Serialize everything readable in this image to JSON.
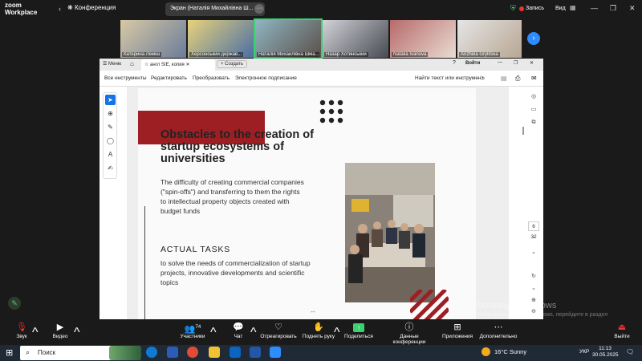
{
  "zoom": {
    "logo_line1": "zoom",
    "logo_line2": "Workplace",
    "conference_label": "Конференция",
    "share_title": "Экран (Наталія Михайлівна Ш...",
    "record_label": "Запись",
    "view_label": "Вид",
    "accent_green": "#3bd16f",
    "accent_blue": "#2d8cff"
  },
  "gallery": [
    {
      "name": "Катерина Леміш",
      "active": false
    },
    {
      "name": "Херсонський держав...",
      "active": false
    },
    {
      "name": "Наталія Михайлівна Шма...",
      "active": true
    },
    {
      "name": "Назар Хотинський",
      "active": false
    },
    {
      "name": "Natalia Ivanova",
      "active": false
    },
    {
      "name": "Anzhela Grylitska",
      "active": false
    }
  ],
  "acrobat": {
    "menu_label": "Меню",
    "tab_title": "англ SIE, копия",
    "new_tab_label": "Создать",
    "signin_label": "Войти",
    "tools": [
      "Все инструменты",
      "Редактировать",
      "Преобразовать",
      "Электронное подписание"
    ],
    "find_label": "Найти текст или инструмент",
    "page_current": "6",
    "page_total": "32"
  },
  "slide": {
    "title": "Obstacles to the creation of startup ecosystems of universities",
    "body": "The difficulty of creating commercial companies (\"spin-offs\") and transferring to them the rights to intellectual property objects created with budget funds",
    "heading": "ACTUAL TASKS",
    "tasks": "to solve the needs of commercialization of startup projects, innovative developments and scientific topics",
    "accent_red": "#9d1f24"
  },
  "watermark": {
    "line1": "Активация Windows",
    "line2": "Чтобы активировать Windows, перейдите в раздел \"Параметры\"."
  },
  "toolbar": [
    {
      "label": "Звук",
      "icon": "mic-muted-icon"
    },
    {
      "label": "Видео",
      "icon": "camera-icon"
    },
    {
      "label": "Участники",
      "icon": "participants-icon",
      "count": "74"
    },
    {
      "label": "Чат",
      "icon": "chat-icon"
    },
    {
      "label": "Отреагировать",
      "icon": "heart-icon"
    },
    {
      "label": "Поднять руку",
      "icon": "hand-icon"
    },
    {
      "label": "Поделиться",
      "icon": "share-icon"
    },
    {
      "label": "Данные конференции",
      "icon": "info-icon"
    },
    {
      "label": "Приложения",
      "icon": "apps-icon"
    },
    {
      "label": "Дополнительно",
      "icon": "more-icon"
    },
    {
      "label": "Выйти",
      "icon": "leave-icon"
    }
  ],
  "taskbar": {
    "search_placeholder": "Поиск",
    "weather": "16°C  Sunny",
    "lang": "УКР",
    "time": "11:13",
    "date": "30.05.2025"
  }
}
